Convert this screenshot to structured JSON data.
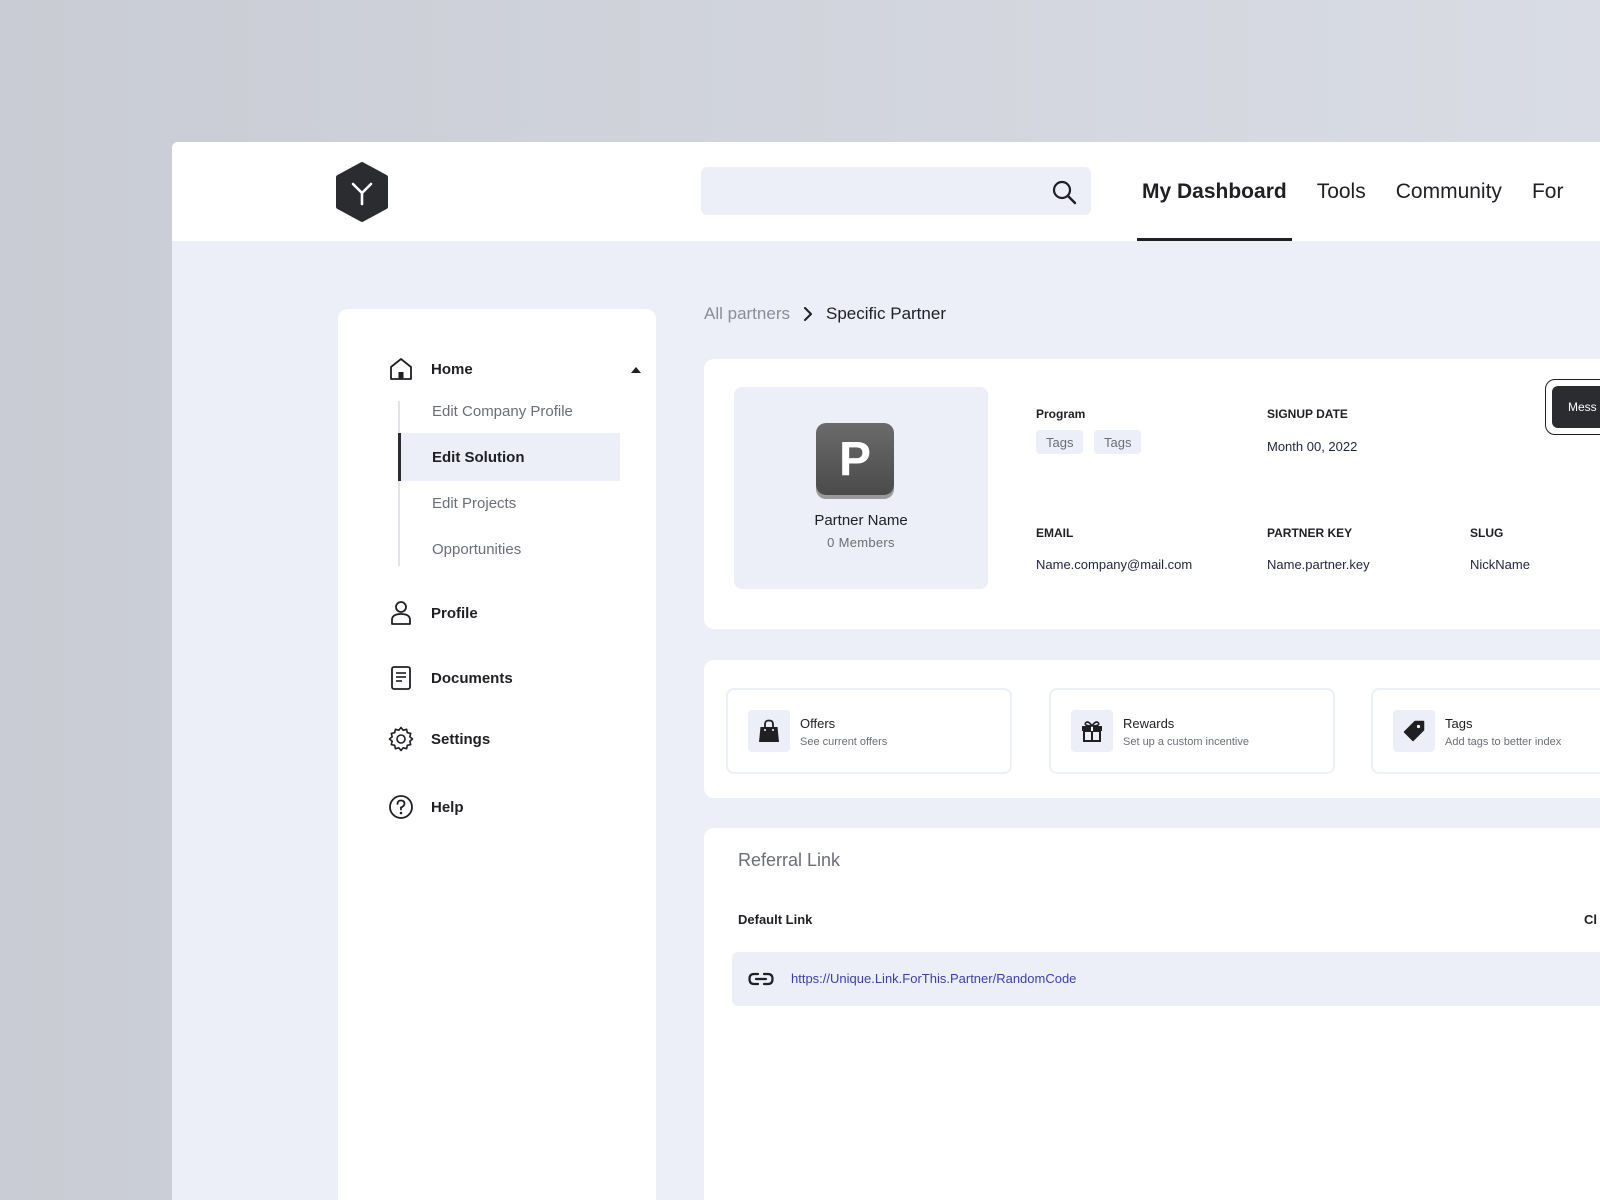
{
  "header": {
    "search_placeholder": "",
    "nav": [
      {
        "label": "My Dashboard",
        "active": true
      },
      {
        "label": "Tools",
        "active": false
      },
      {
        "label": "Community",
        "active": false
      },
      {
        "label": "For",
        "active": false
      }
    ]
  },
  "sidebar": {
    "home": "Home",
    "sub_items": [
      "Edit Company Profile",
      "Edit Solution",
      "Edit Projects",
      "Opportunities"
    ],
    "active_sub": "Edit Solution",
    "profile": "Profile",
    "documents": "Documents",
    "settings": "Settings",
    "help": "Help"
  },
  "breadcrumb": {
    "parent": "All partners",
    "current": "Specific Partner"
  },
  "partner": {
    "avatar_letter": "P",
    "name": "Partner Name",
    "members": "0 Members",
    "program_label": "Program",
    "tags": [
      "Tags",
      "Tags"
    ],
    "signup_label": "SIGNUP DATE",
    "signup_value": "Month 00, 2022",
    "email_label": "EMAIL",
    "email_value": "Name.company@mail.com",
    "key_label": "PARTNER KEY",
    "key_value": "Name.partner.key",
    "slug_label": "SLUG",
    "slug_value": "NickName",
    "message_button": "Mess"
  },
  "actions": [
    {
      "title": "Offers",
      "subtitle": "See current offers",
      "icon": "shopping-bag-icon"
    },
    {
      "title": "Rewards",
      "subtitle": "Set up a custom incentive",
      "icon": "gift-icon"
    },
    {
      "title": "Tags",
      "subtitle": "Add tags to better index",
      "icon": "tag-icon"
    }
  ],
  "referral": {
    "title": "Referral Link",
    "default_label": "Default Link",
    "right_label": "Cl",
    "link": "https://Unique.Link.ForThis.Partner/RandomCode"
  },
  "colors": {
    "background": "#eceff7",
    "surface": "#ffffff",
    "dark": "#2b2c30",
    "link": "#3a3fb0"
  }
}
